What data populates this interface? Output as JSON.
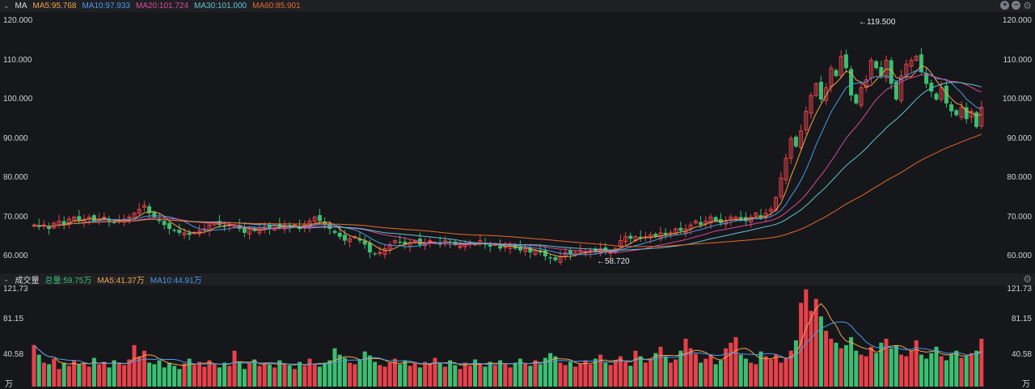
{
  "price_header": {
    "title": "MA",
    "ma5": "MA5:95.768",
    "ma10": "MA10:97.933",
    "ma20": "MA20:101.724",
    "ma30": "MA30:101.000",
    "ma60": "MA60:85.901"
  },
  "volume_header": {
    "title": "成交量",
    "total": "总量:59.75万",
    "ma5": "MA5:41.37万",
    "ma10": "MA10:44.91万"
  },
  "colors": {
    "up": "#e8414b",
    "down": "#3bbf72",
    "ma5": "#f2a54a",
    "ma10": "#4a9be8",
    "ma20": "#d9499a",
    "ma30": "#5fc3d6",
    "ma60": "#e8692c",
    "bg": "#16171a"
  },
  "chart_data": {
    "type": "candlestick",
    "price_axis": {
      "ylim": [
        60,
        120
      ],
      "ticks": [
        "120.000",
        "110.000",
        "100.000",
        "90.000",
        "80.000",
        "70.000",
        "60.000"
      ]
    },
    "volume_axis": {
      "ylim": [
        0,
        121.73
      ],
      "ticks": [
        "121.73",
        "81.15",
        "40.58"
      ],
      "unit": "万"
    },
    "annotations": {
      "max": "←119.500",
      "min": "←58.720"
    },
    "close": [
      68,
      67.5,
      68,
      67,
      68.5,
      69,
      68,
      69.5,
      70,
      69,
      69.5,
      70,
      69,
      69.5,
      70,
      69,
      68.5,
      69,
      69.5,
      70,
      71,
      72,
      73,
      71,
      70,
      69,
      68,
      67,
      66.5,
      66,
      66,
      65.5,
      66,
      66.5,
      67,
      68,
      68.5,
      68,
      67.5,
      68,
      68,
      67,
      66,
      67,
      66.5,
      67,
      67.5,
      67,
      68,
      67.5,
      68,
      67.5,
      68,
      67,
      68,
      69,
      70,
      69,
      68,
      67,
      66,
      65,
      64,
      64.5,
      65,
      64,
      63,
      61,
      60.5,
      61,
      62,
      63,
      64,
      63.5,
      63,
      63.5,
      64,
      63,
      63.5,
      64,
      63.5,
      63,
      64,
      63.5,
      63,
      62.5,
      63,
      63.5,
      63,
      64,
      63,
      62.5,
      63,
      62,
      62.5,
      63,
      62,
      61.5,
      62,
      61,
      61.5,
      61,
      60,
      59.5,
      59,
      60,
      61,
      60.5,
      61,
      61.5,
      61,
      61.5,
      61,
      62,
      61.5,
      61,
      62,
      64,
      65,
      64.5,
      65,
      64.5,
      65,
      65.5,
      65,
      66,
      65.5,
      66,
      67,
      66.5,
      67,
      68,
      69,
      68,
      69,
      70,
      69,
      68.5,
      69,
      70,
      70,
      69.5,
      69,
      70,
      71,
      70,
      71,
      72,
      75,
      80,
      85,
      90,
      88,
      92,
      97,
      101,
      104,
      100,
      103,
      108,
      106,
      111,
      108,
      101,
      99,
      103,
      105,
      110,
      108,
      106,
      110,
      104,
      100,
      106,
      109,
      110,
      111,
      107,
      104,
      102,
      100,
      103,
      99,
      97,
      96,
      98,
      95,
      97,
      93,
      98
    ],
    "volume": [
      52,
      40,
      30,
      28,
      35,
      22,
      30,
      26,
      33,
      28,
      30,
      25,
      36,
      28,
      31,
      24,
      33,
      29,
      27,
      34,
      52,
      38,
      45,
      30,
      28,
      33,
      24,
      30,
      26,
      22,
      29,
      35,
      27,
      31,
      25,
      33,
      28,
      24,
      30,
      26,
      45,
      31,
      22,
      29,
      34,
      26,
      30,
      28,
      24,
      33,
      29,
      27,
      22,
      31,
      26,
      35,
      28,
      25,
      30,
      33,
      48,
      40,
      36,
      30,
      28,
      34,
      44,
      39,
      31,
      27,
      25,
      30,
      35,
      28,
      33,
      26,
      30,
      24,
      31,
      28,
      36,
      29,
      25,
      33,
      27,
      22,
      30,
      26,
      34,
      29,
      25,
      31,
      27,
      33,
      28,
      24,
      30,
      35,
      29,
      26,
      33,
      28,
      36,
      42,
      38,
      30,
      27,
      31,
      25,
      29,
      33,
      28,
      35,
      40,
      30,
      27,
      33,
      38,
      31,
      26,
      45,
      38,
      30,
      35,
      42,
      50,
      38,
      30,
      34,
      45,
      60,
      48,
      41,
      30,
      35,
      40,
      28,
      33,
      48,
      55,
      62,
      40,
      35,
      30,
      28,
      44,
      38,
      34,
      40,
      30,
      36,
      45,
      58,
      105,
      122,
      95,
      110,
      88,
      70,
      60,
      55,
      48,
      52,
      62,
      45,
      40,
      38,
      50,
      42,
      55,
      60,
      48,
      52,
      40,
      38,
      45,
      58,
      40,
      35,
      42,
      50,
      38,
      33,
      40,
      45,
      36,
      38,
      42,
      45,
      60
    ]
  }
}
